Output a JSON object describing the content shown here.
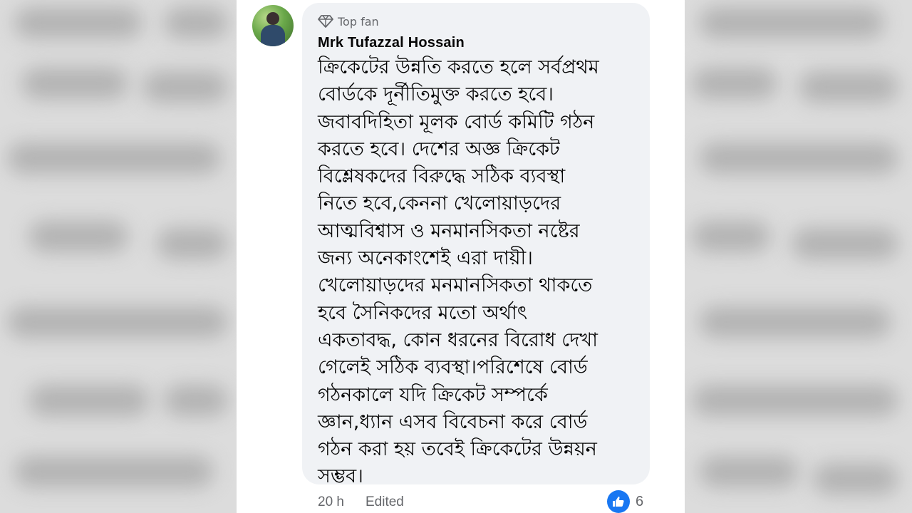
{
  "comment": {
    "badge_label": "Top fan",
    "author": "Mrk Tufazzal Hossain",
    "lines": [
      "ক্রিকেটের উন্নতি করতে হলে সর্বপ্রথম",
      "বোর্ডকে দূর্নীতিমুক্ত করতে হবে।",
      "জবাবদিহিতা মূলক বোর্ড কমিটি গঠন",
      "করতে হবে। দেশের অজ্ঞ ক্রিকেট",
      "বিশ্লেষকদের বিরুদ্ধে সঠিক ব্যবস্থা",
      "নিতে হবে,কেননা খেলোয়াড়দের",
      "আত্মবিশ্বাস ও মনমানসিকতা নষ্টের",
      "জন্য অনেকাংশেই এরা দায়ী।",
      "খেলোয়াড়দের মনমানসিকতা থাকতে",
      "হবে সৈনিকদের মতো অর্থাৎ",
      "একতাবদ্ধ, কোন ধরনের বিরোধ দেখা",
      "গেলেই সঠিক ব্যবস্থা।পরিশেষে বোর্ড",
      "গঠনকালে যদি ক্রিকেট সম্পর্কে",
      "জ্ঞান,ধ্যান এসব বিবেচনা করে বোর্ড",
      "গঠন করা হয় তবেই ক্রিকেটের উন্নয়ন",
      "সম্ভব।"
    ],
    "time": "20 h",
    "edited_label": "Edited",
    "reaction_count": "6",
    "icons": {
      "badge": "diamond-icon",
      "reaction": "like-icon"
    },
    "colors": {
      "bubble": "#f0f2f5",
      "secondary_text": "#65676b",
      "like_blue": "#1877f2"
    }
  }
}
